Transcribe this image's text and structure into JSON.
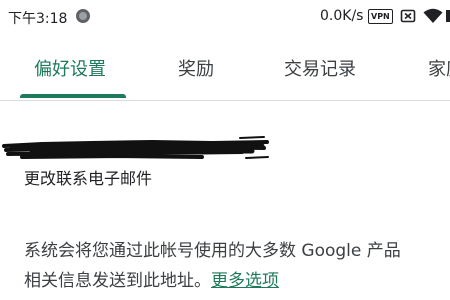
{
  "status_bar": {
    "time": "下午3:18",
    "network_speed": "0.0K/s",
    "vpn_badge": "VPN",
    "icons": [
      "record-indicator-icon",
      "sim-slot-icon",
      "wifi-icon",
      "battery-icon"
    ]
  },
  "tabs": [
    {
      "label": "偏好设置",
      "active": true
    },
    {
      "label": "奖励",
      "active": false
    },
    {
      "label": "交易记录",
      "active": false
    },
    {
      "label": "家庭",
      "active": false
    }
  ],
  "account": {
    "email": "",
    "change_email_label": "更改联系电子邮件"
  },
  "description": {
    "line1": "系统会将您通过此帐号使用的大多数 Google 产品",
    "line2": "相关信息发送到此地址。",
    "more_link": "更多选项"
  },
  "colors": {
    "accent": "#1e7a5a",
    "text_primary": "#202124",
    "text_secondary": "#3c4043",
    "divider": "#dadce0"
  }
}
